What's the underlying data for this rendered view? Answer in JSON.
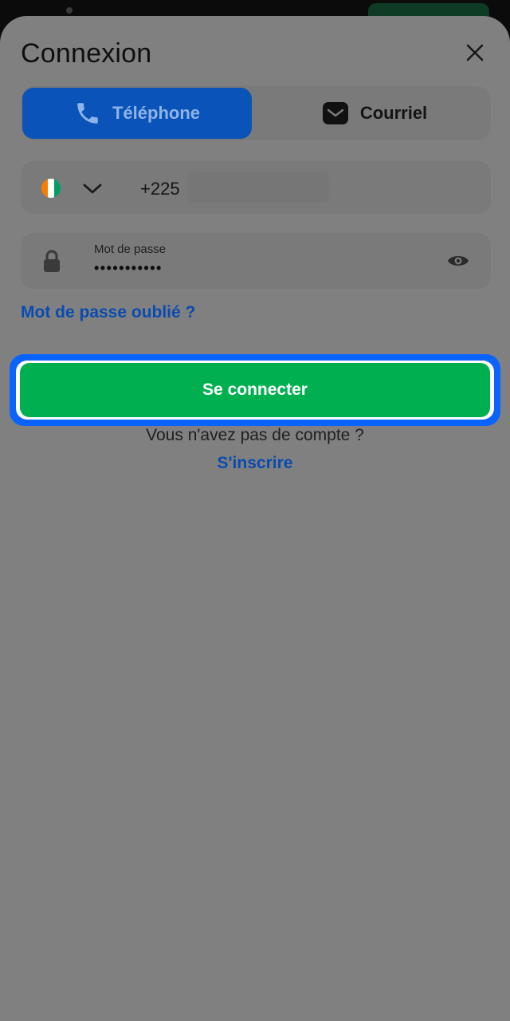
{
  "header": {
    "title": "Connexion",
    "close_icon": "close-icon"
  },
  "tabs": [
    {
      "label": "Téléphone",
      "icon": "phone-icon",
      "active": true
    },
    {
      "label": "Courriel",
      "icon": "mail-icon",
      "active": false
    }
  ],
  "phone_field": {
    "country_flag": "cote-divoire-flag-icon",
    "dropdown_icon": "chevron-down-icon",
    "prefix": "+225",
    "number_obscured": true
  },
  "password_field": {
    "label": "Mot de passe",
    "value": "•••••••••••",
    "lock_icon": "lock-icon",
    "toggle_icon": "eye-icon"
  },
  "forgot_password": "Mot de passe oublié ?",
  "login_button": "Se connecter",
  "no_account_text": "Vous n'avez pas de compte ?",
  "signup_link": "S'inscrire",
  "colors": {
    "overlay": "#808080",
    "primary_blue": "#0a53b8",
    "focus_blue": "#0a63ff",
    "button_green": "#00b050",
    "link_blue": "#0a4bb0",
    "flag_orange": "#f77f00",
    "flag_white": "#ffffff",
    "flag_green": "#009e60"
  }
}
